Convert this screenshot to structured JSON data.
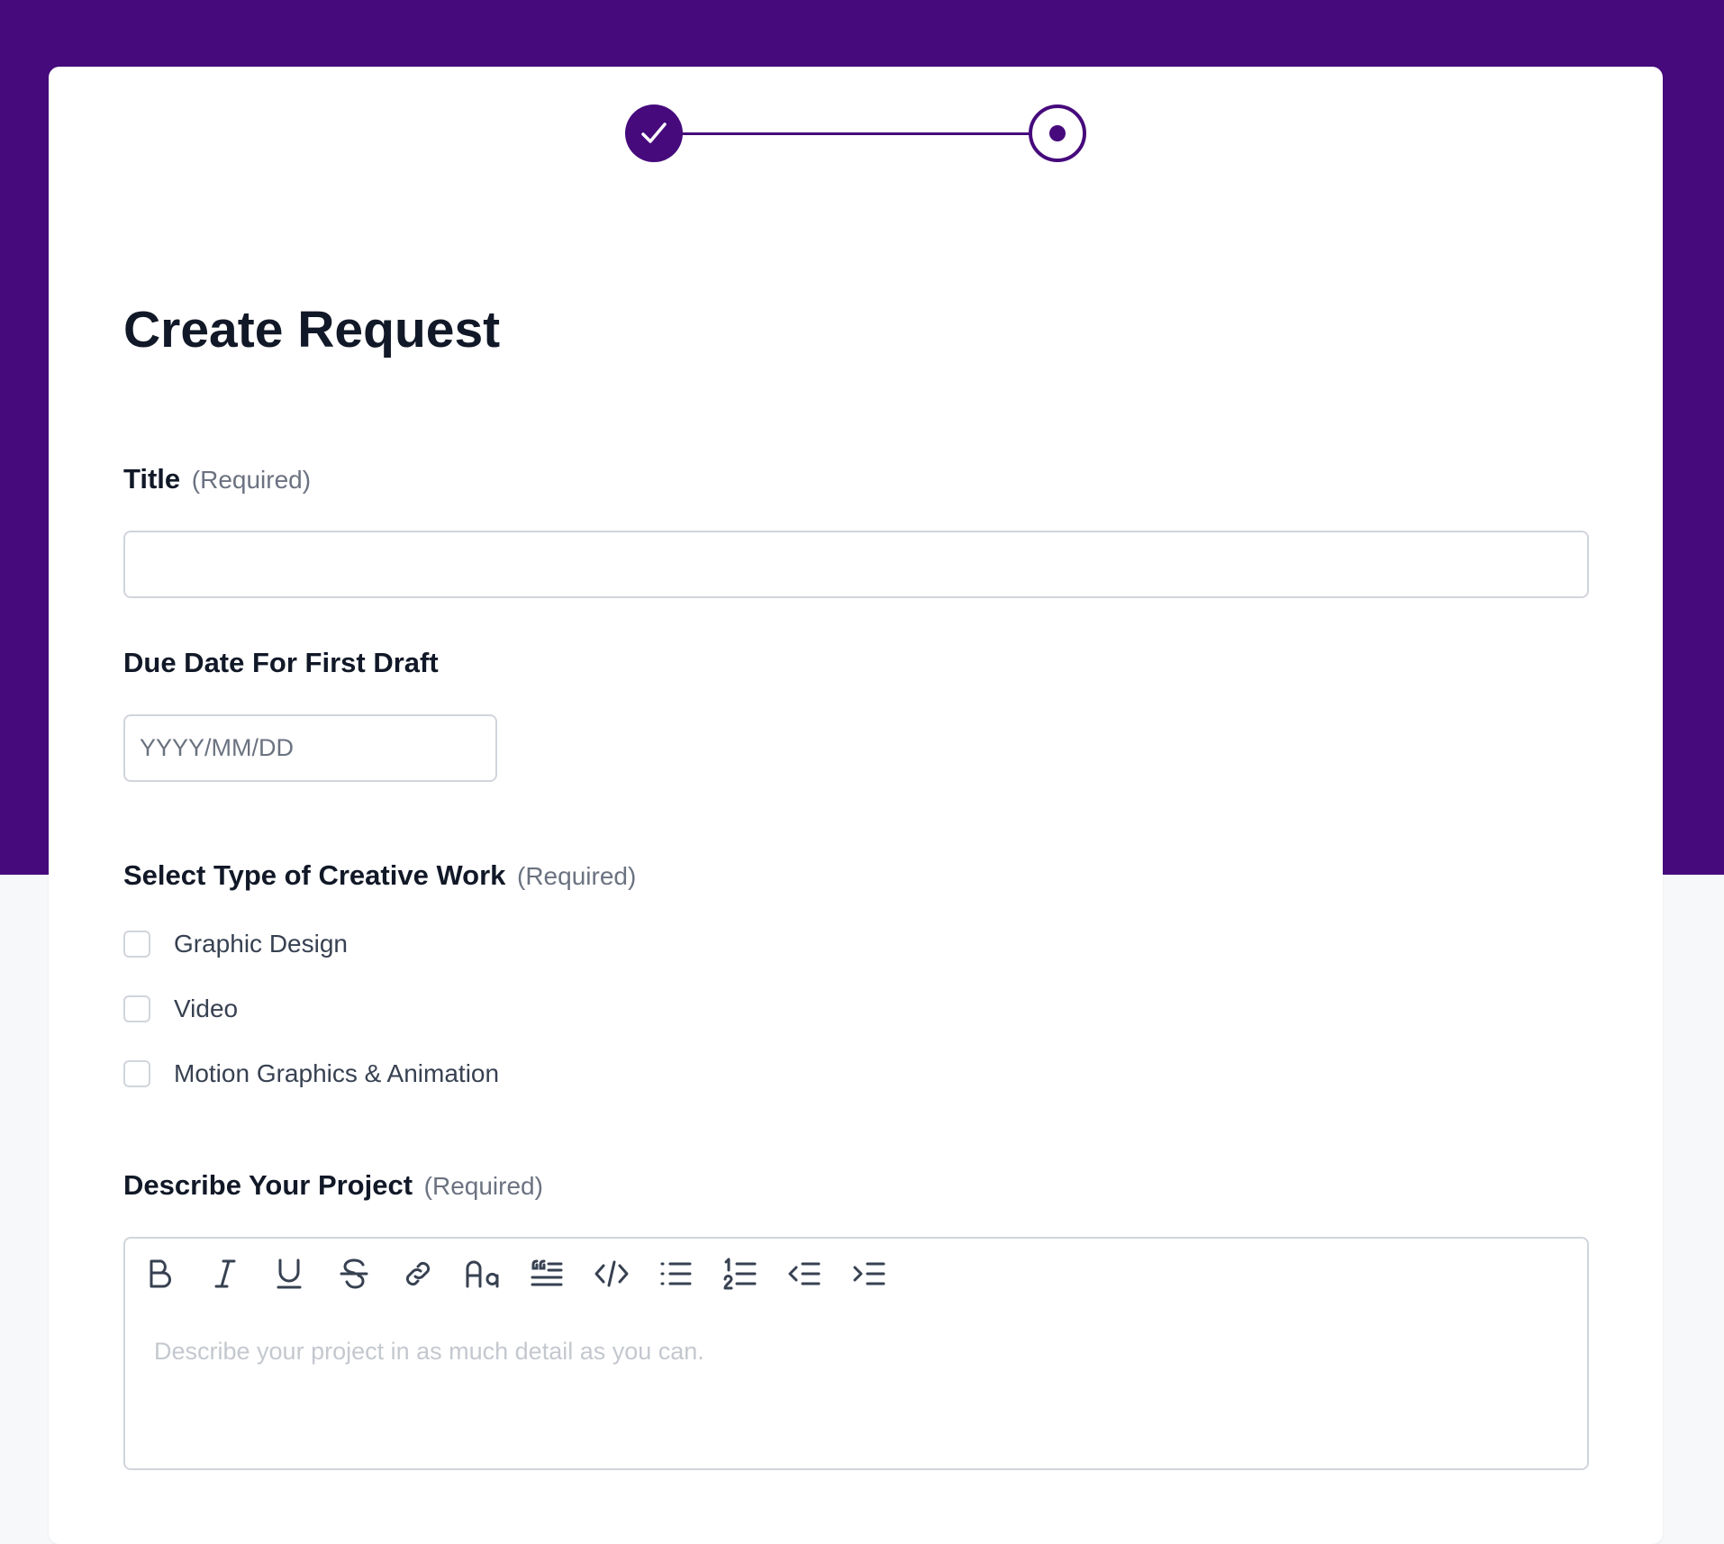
{
  "page": {
    "title": "Create Request"
  },
  "stepper": {
    "steps": [
      {
        "state": "completed"
      },
      {
        "state": "current"
      }
    ]
  },
  "fields": {
    "title": {
      "label": "Title",
      "hint": "(Required)",
      "value": "",
      "placeholder": ""
    },
    "due_date": {
      "label": "Due Date For First Draft",
      "value": "",
      "placeholder": "YYYY/MM/DD"
    },
    "work_type": {
      "label": "Select Type of Creative Work",
      "hint": "(Required)",
      "options": [
        {
          "label": "Graphic Design",
          "checked": false
        },
        {
          "label": "Video",
          "checked": false
        },
        {
          "label": "Motion Graphics & Animation",
          "checked": false
        }
      ]
    },
    "description": {
      "label": "Describe Your Project",
      "hint": "(Required)",
      "placeholder": "Describe your project in as much detail as you can.",
      "toolbar": [
        "bold-icon",
        "italic-icon",
        "underline-icon",
        "strikethrough-icon",
        "link-icon",
        "heading-icon",
        "quote-icon",
        "code-icon",
        "bullet-list-icon",
        "numbered-list-icon",
        "outdent-icon",
        "indent-icon"
      ]
    }
  },
  "colors": {
    "brand": "#460a7c",
    "page_bg": "#f7f8fa",
    "border": "#d1d5db",
    "hint": "#6b7280",
    "heading": "#111827"
  }
}
